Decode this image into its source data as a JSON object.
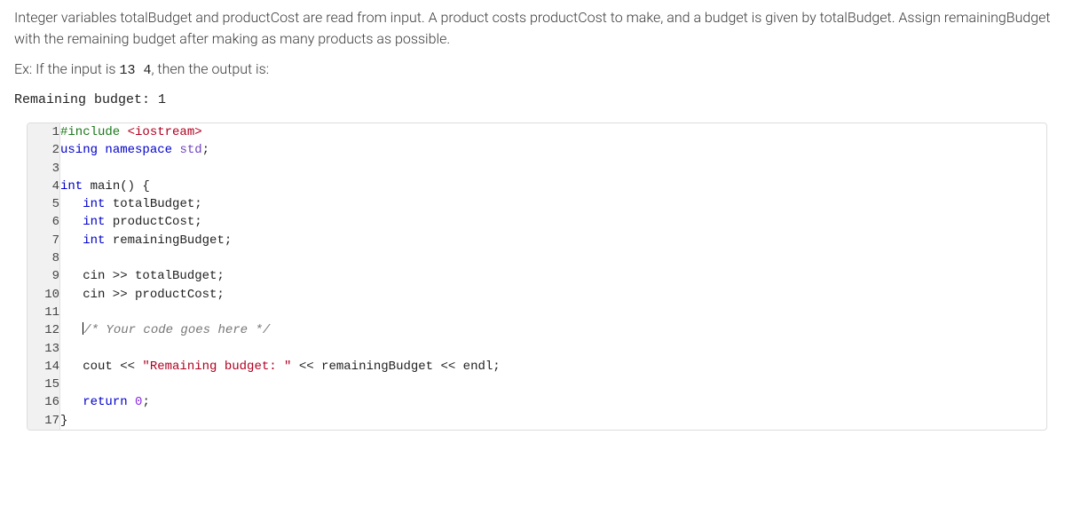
{
  "problem": {
    "p1": "Integer variables totalBudget and productCost are read from input. A product costs productCost to make, and a budget is given by totalBudget. Assign remainingBudget with the remaining budget after making as many products as possible.",
    "p2_a": "Ex: If the input is ",
    "p2_code": "13 4",
    "p2_b": ", then the output is:",
    "example_output": "Remaining budget: 1"
  },
  "code": {
    "lines": [
      {
        "n": "1",
        "tokens": [
          {
            "t": "#include ",
            "c": "k-pp"
          },
          {
            "t": "<iostream>",
            "c": "k-str"
          }
        ]
      },
      {
        "n": "2",
        "tokens": [
          {
            "t": "using ",
            "c": "k-kw"
          },
          {
            "t": "namespace ",
            "c": "k-kw"
          },
          {
            "t": "std",
            "c": "k-ns"
          },
          {
            "t": ";",
            "c": ""
          }
        ]
      },
      {
        "n": "3",
        "tokens": []
      },
      {
        "n": "4",
        "tokens": [
          {
            "t": "int ",
            "c": "k-ty"
          },
          {
            "t": "main",
            "c": ""
          },
          {
            "t": "() {",
            "c": ""
          }
        ]
      },
      {
        "n": "5",
        "tokens": [
          {
            "t": "   ",
            "c": ""
          },
          {
            "t": "int ",
            "c": "k-ty"
          },
          {
            "t": "totalBudget;",
            "c": ""
          }
        ]
      },
      {
        "n": "6",
        "tokens": [
          {
            "t": "   ",
            "c": ""
          },
          {
            "t": "int ",
            "c": "k-ty"
          },
          {
            "t": "productCost;",
            "c": ""
          }
        ]
      },
      {
        "n": "7",
        "tokens": [
          {
            "t": "   ",
            "c": ""
          },
          {
            "t": "int ",
            "c": "k-ty"
          },
          {
            "t": "remainingBudget;",
            "c": ""
          }
        ]
      },
      {
        "n": "8",
        "tokens": []
      },
      {
        "n": "9",
        "tokens": [
          {
            "t": "   cin >> totalBudget;",
            "c": ""
          }
        ]
      },
      {
        "n": "10",
        "tokens": [
          {
            "t": "   cin >> productCost;",
            "c": ""
          }
        ]
      },
      {
        "n": "11",
        "tokens": []
      },
      {
        "n": "12",
        "tokens": [
          {
            "t": "   ",
            "c": ""
          },
          {
            "t": "|",
            "c": "cursor"
          },
          {
            "t": "/* Your code goes here */",
            "c": "k-cm"
          }
        ]
      },
      {
        "n": "13",
        "tokens": []
      },
      {
        "n": "14",
        "tokens": [
          {
            "t": "   cout << ",
            "c": ""
          },
          {
            "t": "\"Remaining budget: \"",
            "c": "k-str"
          },
          {
            "t": " << remainingBudget << endl;",
            "c": ""
          }
        ]
      },
      {
        "n": "15",
        "tokens": []
      },
      {
        "n": "16",
        "tokens": [
          {
            "t": "   ",
            "c": ""
          },
          {
            "t": "return ",
            "c": "k-kw"
          },
          {
            "t": "0",
            "c": "k-num"
          },
          {
            "t": ";",
            "c": ""
          }
        ]
      },
      {
        "n": "17",
        "tokens": [
          {
            "t": "}",
            "c": ""
          }
        ]
      }
    ]
  }
}
